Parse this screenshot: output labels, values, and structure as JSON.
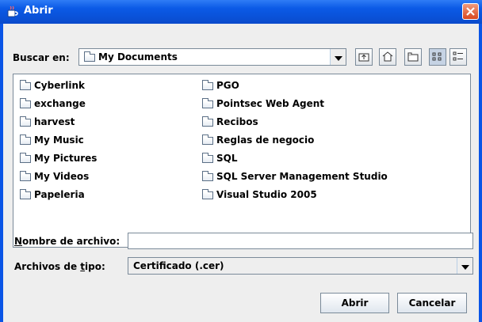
{
  "window": {
    "title": "Abrir"
  },
  "lookin": {
    "label": "Buscar en:",
    "value": "My Documents"
  },
  "toolbar": [
    "up-one-level-icon",
    "home-icon",
    "new-folder-icon",
    "list-view-icon",
    "details-view-icon"
  ],
  "files": {
    "left": [
      "Cyberlink",
      "exchange",
      "harvest",
      "My Music",
      "My Pictures",
      "My Videos",
      "Papeleria"
    ],
    "right": [
      "PGO",
      "Pointsec Web Agent",
      "Recibos",
      "Reglas de negocio",
      "SQL",
      "SQL Server Management Studio",
      "Visual Studio 2005"
    ]
  },
  "filename": {
    "label_mnemonic": "N",
    "label_rest": "ombre de archivo:",
    "value": ""
  },
  "filetype": {
    "label_start": "Archivos de ",
    "label_mnemonic": "t",
    "label_end": "ipo:",
    "value": "Certificado (.cer)"
  },
  "buttons": {
    "open": "Abrir",
    "cancel": "Cancelar"
  }
}
